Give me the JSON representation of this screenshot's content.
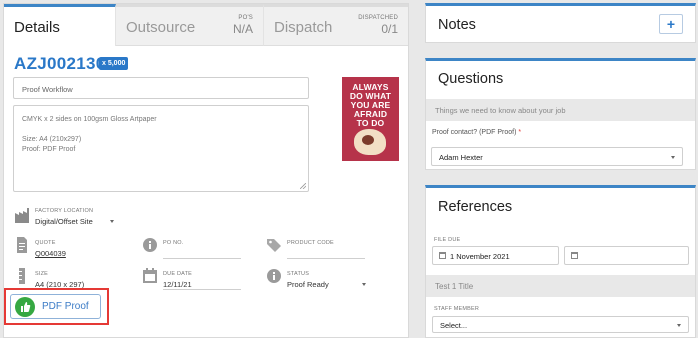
{
  "tabs": [
    {
      "title": "Details",
      "sub_label": "",
      "sub_value": ""
    },
    {
      "title": "Outsource",
      "sub_label": "PO'S",
      "sub_value": "N/A"
    },
    {
      "title": "Dispatch",
      "sub_label": "DISPATCHED",
      "sub_value": "0/1"
    }
  ],
  "job": {
    "number": "AZJ002130",
    "quantity": "x 5,000",
    "workflow": "Proof Workflow",
    "description_lines": [
      "CMYK x 2 sides  on 100gsm Gloss Artpaper",
      "",
      "Size: A4 (210x297)",
      "Proof: PDF Proof"
    ],
    "thumbnail_text": [
      "ALWAYS",
      "DO WHAT",
      "YOU ARE",
      "AFRAID",
      "TO DO"
    ]
  },
  "fields": {
    "factory_location": {
      "label": "FACTORY LOCATION",
      "value": "Digital/Offset Site"
    },
    "quote": {
      "label": "QUOTE",
      "value": "Q004039"
    },
    "po_no": {
      "label": "PO NO.",
      "value": ""
    },
    "product_code": {
      "label": "PRODUCT CODE",
      "value": ""
    },
    "size": {
      "label": "SIZE",
      "value": "A4 (210 x 297)"
    },
    "due_date": {
      "label": "DUE DATE",
      "value": "12/11/21"
    },
    "status": {
      "label": "STATUS",
      "value": "Proof Ready"
    }
  },
  "proof_button": {
    "label": "PDF Proof"
  },
  "notes": {
    "title": "Notes",
    "add_label": "+"
  },
  "questions": {
    "title": "Questions",
    "banner": "Things we need to know about your job",
    "proof_contact_label": "Proof contact? (PDF Proof)",
    "required_mark": "*",
    "proof_contact_value": "Adam Hexter"
  },
  "references": {
    "title": "References",
    "file_due_label": "FILE DUE",
    "file_due_value": "1 November 2021",
    "file_due_time": "",
    "section_title": "Test 1 Title",
    "staff_member_label": "STAFF MEMBER",
    "staff_member_value": "Select..."
  },
  "colors": {
    "accent": "#3d85c6",
    "brand_blue": "#2a78c8",
    "success": "#36a842",
    "highlight": "#e53935"
  }
}
